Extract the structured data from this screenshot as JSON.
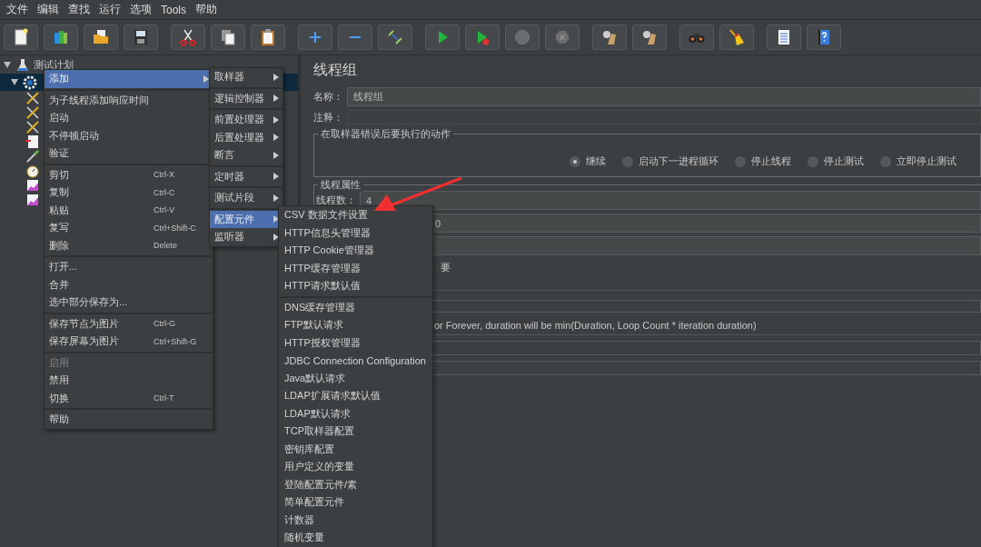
{
  "menu_bar": [
    {
      "label": "文件"
    },
    {
      "label": "编辑"
    },
    {
      "label": "查找"
    },
    {
      "label": "运行"
    },
    {
      "label": "选项"
    },
    {
      "label": "Tools"
    },
    {
      "label": "帮助"
    }
  ],
  "toolbar": [
    {
      "disabled": false
    },
    {
      "disabled": false
    },
    {
      "disabled": false
    },
    {
      "disabled": false
    },
    {
      "disabled": false
    },
    {
      "disabled": false
    },
    {
      "disabled": false
    },
    {
      "disabled": false
    },
    {
      "disabled": false
    },
    {
      "disabled": false
    },
    {
      "disabled": false
    },
    {
      "disabled": false
    },
    {
      "disabled": true
    },
    {
      "disabled": true
    },
    {
      "disabled": false
    },
    {
      "disabled": false
    },
    {
      "disabled": false
    },
    {
      "disabled": false
    },
    {
      "disabled": false
    },
    {
      "disabled": false
    }
  ],
  "tree": {
    "label": "测试计划",
    "expanded": true,
    "children": [
      {
        "selected": true,
        "expanded": true,
        "children": [
          {
            "kind": "tool"
          },
          {
            "kind": "tool"
          },
          {
            "kind": "tool"
          },
          {
            "kind": "document"
          },
          {
            "kind": "pipette"
          },
          {
            "kind": "timer"
          },
          {
            "kind": "chart"
          },
          {
            "kind": "chart"
          }
        ]
      }
    ]
  },
  "panel": {
    "title": "线程组",
    "name_label": "名称：",
    "name_value": "线程组",
    "comment_label": "注释：",
    "error_action": {
      "legend": "在取样器错误后要执行的动作",
      "options": [
        {
          "label": "继续",
          "selected": true
        },
        {
          "label": "启动下一进程循环",
          "selected": false
        },
        {
          "label": "停止线程",
          "selected": false
        },
        {
          "label": "停止测试",
          "selected": false
        },
        {
          "label": "立即停止测试",
          "selected": false
        }
      ]
    },
    "thread_properties": {
      "legend": "线程属性",
      "threads_label": "线程数：",
      "threads_value": "4",
      "field_2_value": "0",
      "partial_label": "要",
      "note": "or Forever, duration will be min(Duration, Loop Count * iteration duration)"
    }
  },
  "context_menu": {
    "groups": [
      [
        {
          "label": "添加",
          "submenu": true,
          "selected": true,
          "disabled": false
        }
      ],
      [
        {
          "label": "为子线程添加响应时间",
          "submenu": false,
          "selected": false,
          "disabled": false
        },
        {
          "label": "启动",
          "submenu": false,
          "selected": false,
          "disabled": false
        },
        {
          "label": "不停顿启动",
          "submenu": false,
          "selected": false,
          "disabled": false
        },
        {
          "label": "验证",
          "submenu": false,
          "selected": false,
          "disabled": false
        }
      ],
      [
        {
          "label": "剪切",
          "shortcut": "Ctrl-X",
          "submenu": false,
          "selected": false,
          "disabled": false
        },
        {
          "label": "复制",
          "shortcut": "Ctrl-C",
          "submenu": false,
          "selected": false,
          "disabled": false
        },
        {
          "label": "粘贴",
          "shortcut": "Ctrl-V",
          "submenu": false,
          "selected": false,
          "disabled": false
        },
        {
          "label": "复写",
          "shortcut": "Ctrl+Shift-C",
          "submenu": false,
          "selected": false,
          "disabled": false
        },
        {
          "label": "删除",
          "shortcut": "Delete",
          "submenu": false,
          "selected": false,
          "disabled": false
        }
      ],
      [
        {
          "label": "打开...",
          "submenu": false,
          "selected": false,
          "disabled": false
        },
        {
          "label": "合并",
          "submenu": false,
          "selected": false,
          "disabled": false
        },
        {
          "label": "选中部分保存为...",
          "submenu": false,
          "selected": false,
          "disabled": false
        }
      ],
      [
        {
          "label": "保存节点为图片",
          "shortcut": "Ctrl-G",
          "submenu": false,
          "selected": false,
          "disabled": false
        },
        {
          "label": "保存屏幕为图片",
          "shortcut": "Ctrl+Shift-G",
          "submenu": false,
          "selected": false,
          "disabled": false
        }
      ],
      [
        {
          "label": "启用",
          "submenu": false,
          "selected": false,
          "disabled": true
        },
        {
          "label": "禁用",
          "submenu": false,
          "selected": false,
          "disabled": false
        },
        {
          "label": "切换",
          "shortcut": "Ctrl-T",
          "submenu": false,
          "selected": false,
          "disabled": false
        }
      ],
      [
        {
          "label": "帮助",
          "submenu": false,
          "selected": false,
          "disabled": false
        }
      ]
    ]
  },
  "add_submenu": {
    "groups": [
      [
        {
          "label": "取样器",
          "selected": false
        }
      ],
      [
        {
          "label": "逻辑控制器",
          "selected": false
        }
      ],
      [
        {
          "label": "前置处理器",
          "selected": false
        },
        {
          "label": "后置处理器",
          "selected": false
        },
        {
          "label": "断言",
          "selected": false
        }
      ],
      [
        {
          "label": "定时器",
          "selected": false
        }
      ],
      [
        {
          "label": "测试片段",
          "selected": false
        }
      ],
      [
        {
          "label": "配置元件",
          "selected": true
        },
        {
          "label": "监听器",
          "selected": false
        }
      ]
    ]
  },
  "config_submenu": {
    "groups": [
      [
        {
          "label": "CSV 数据文件设置"
        },
        {
          "label": "HTTP信息头管理器"
        },
        {
          "label": "HTTP Cookie管理器"
        },
        {
          "label": "HTTP缓存管理器"
        },
        {
          "label": "HTTP请求默认值"
        }
      ],
      [
        {
          "label": "DNS缓存管理器"
        },
        {
          "label": "FTP默认请求"
        },
        {
          "label": "HTTP授权管理器"
        },
        {
          "label": "JDBC Connection Configuration"
        },
        {
          "label": "Java默认请求"
        },
        {
          "label": "LDAP扩展请求默认值"
        },
        {
          "label": "LDAP默认请求"
        },
        {
          "label": "TCP取样器配置"
        },
        {
          "label": "密钥库配置"
        },
        {
          "label": "用户定义的变量"
        },
        {
          "label": "登陆配置元件/素"
        },
        {
          "label": "简单配置元件"
        },
        {
          "label": "计数器"
        },
        {
          "label": "随机变量"
        }
      ]
    ]
  }
}
